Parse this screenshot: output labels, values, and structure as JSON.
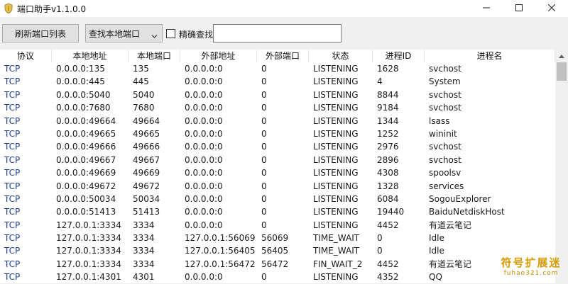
{
  "window": {
    "title": "端口助手v1.1.0.0",
    "icons": [
      "app-icon",
      "minimize-icon",
      "maximize-icon",
      "close-icon"
    ]
  },
  "toolbar": {
    "refresh_label": "刷新端口列表",
    "mode_select": "查找本地端口",
    "exact_label": "精确查找",
    "exact_checked": false,
    "search_value": ""
  },
  "table": {
    "columns": [
      "协议",
      "本地地址",
      "本地端口",
      "外部地址",
      "外部端口",
      "状态",
      "进程ID",
      "进程名"
    ],
    "rows": [
      [
        "TCP",
        "0.0.0.0:135",
        "135",
        "0.0.0.0:0",
        "0",
        "LISTENING",
        "1628",
        "svchost"
      ],
      [
        "TCP",
        "0.0.0.0:445",
        "445",
        "0.0.0.0:0",
        "0",
        "LISTENING",
        "4",
        "System"
      ],
      [
        "TCP",
        "0.0.0.0:5040",
        "5040",
        "0.0.0.0:0",
        "0",
        "LISTENING",
        "8844",
        "svchost"
      ],
      [
        "TCP",
        "0.0.0.0:7680",
        "7680",
        "0.0.0.0:0",
        "0",
        "LISTENING",
        "9184",
        "svchost"
      ],
      [
        "TCP",
        "0.0.0.0:49664",
        "49664",
        "0.0.0.0:0",
        "0",
        "LISTENING",
        "1344",
        "lsass"
      ],
      [
        "TCP",
        "0.0.0.0:49665",
        "49665",
        "0.0.0.0:0",
        "0",
        "LISTENING",
        "1252",
        "wininit"
      ],
      [
        "TCP",
        "0.0.0.0:49666",
        "49666",
        "0.0.0.0:0",
        "0",
        "LISTENING",
        "2976",
        "svchost"
      ],
      [
        "TCP",
        "0.0.0.0:49667",
        "49667",
        "0.0.0.0:0",
        "0",
        "LISTENING",
        "2896",
        "svchost"
      ],
      [
        "TCP",
        "0.0.0.0:49669",
        "49669",
        "0.0.0.0:0",
        "0",
        "LISTENING",
        "4308",
        "spoolsv"
      ],
      [
        "TCP",
        "0.0.0.0:49672",
        "49672",
        "0.0.0.0:0",
        "0",
        "LISTENING",
        "1328",
        "services"
      ],
      [
        "TCP",
        "0.0.0.0:50034",
        "50034",
        "0.0.0.0:0",
        "0",
        "LISTENING",
        "6084",
        "SogouExplorer"
      ],
      [
        "TCP",
        "0.0.0.0:51413",
        "51413",
        "0.0.0.0:0",
        "0",
        "LISTENING",
        "19440",
        "BaiduNetdiskHost"
      ],
      [
        "TCP",
        "127.0.0.1:3334",
        "3334",
        "0.0.0.0:0",
        "0",
        "LISTENING",
        "4452",
        "有道云笔记"
      ],
      [
        "TCP",
        "127.0.0.1:3334",
        "3334",
        "127.0.0.1:56069",
        "56069",
        "TIME_WAIT",
        "0",
        "Idle"
      ],
      [
        "TCP",
        "127.0.0.1:3334",
        "3334",
        "127.0.0.1:56405",
        "56405",
        "TIME_WAIT",
        "0",
        "Idle"
      ],
      [
        "TCP",
        "127.0.0.1:3334",
        "3334",
        "127.0.0.1:56472",
        "56472",
        "FIN_WAIT_2",
        "4452",
        "有道云笔记"
      ],
      [
        "TCP",
        "127.0.0.1:4301",
        "4301",
        "0.0.0.0:0",
        "0",
        "LISTENING",
        "4352",
        "QQ"
      ]
    ]
  },
  "watermark": {
    "main": "符号扩展迷",
    "sub": "fuhao321.com"
  },
  "colors": {
    "protocol_text": "#1f3f8f",
    "watermark": "#d99a00"
  }
}
